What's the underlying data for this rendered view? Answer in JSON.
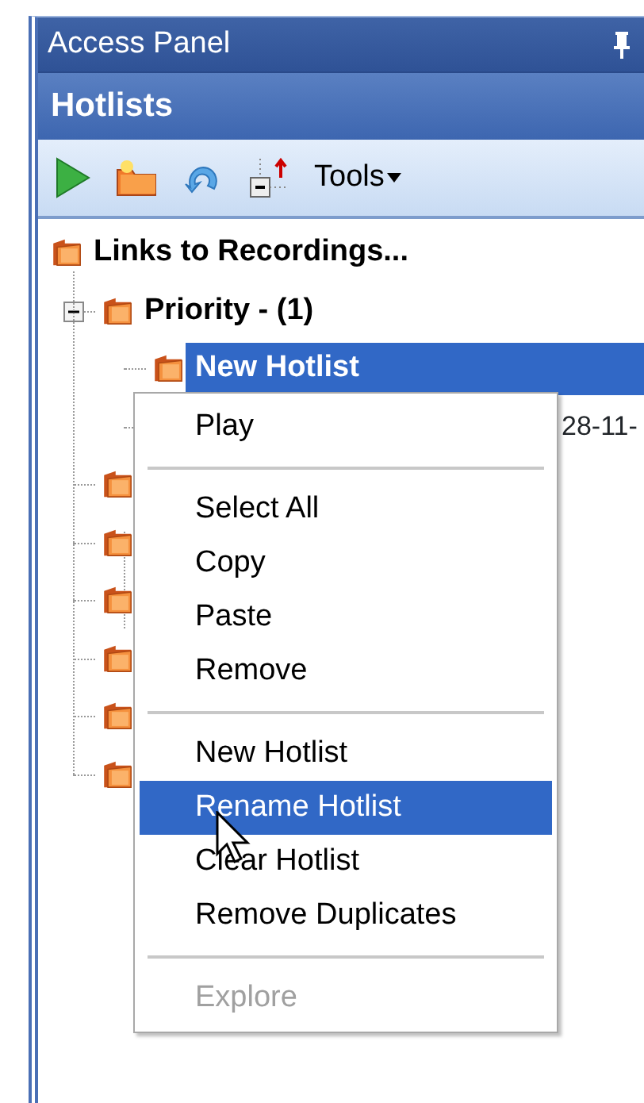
{
  "panel": {
    "title": "Access Panel",
    "header": "Hotlists"
  },
  "toolbar": {
    "menu": "Tools"
  },
  "tree": [
    {
      "kind": "folder",
      "label": "Links to Recordings...",
      "selected": false,
      "children": [
        {
          "kind": "folder",
          "label": "Priority - (1)",
          "selected": false,
          "expanded": true,
          "children": [
            {
              "kind": "folder",
              "label": "New Hotlist",
              "selected": true
            },
            {
              "kind": "covered",
              "label": "28-11-",
              "selected": false
            }
          ]
        },
        {
          "kind": "folder",
          "selected": false
        },
        {
          "kind": "folder",
          "selected": false
        },
        {
          "kind": "folder",
          "selected": false
        },
        {
          "kind": "folder",
          "selected": false
        },
        {
          "kind": "folder",
          "selected": false
        },
        {
          "kind": "folder",
          "selected": false
        }
      ]
    }
  ],
  "context_menu": [
    [
      {
        "label": "Play",
        "selected": false,
        "disabled": false
      }
    ],
    [
      {
        "label": "Select All",
        "selected": false,
        "disabled": false
      },
      {
        "label": "Copy",
        "selected": false,
        "disabled": false
      },
      {
        "label": "Paste",
        "selected": false,
        "disabled": false
      },
      {
        "label": "Remove",
        "selected": false,
        "disabled": false
      }
    ],
    [
      {
        "label": "New Hotlist",
        "selected": false,
        "disabled": false
      },
      {
        "label": "Rename Hotlist",
        "selected": true,
        "disabled": false
      },
      {
        "label": "Clear Hotlist",
        "selected": false,
        "disabled": false
      },
      {
        "label": "Remove Duplicates",
        "selected": false,
        "disabled": false
      }
    ],
    [
      {
        "label": "Explore",
        "selected": false,
        "disabled": true
      }
    ]
  ]
}
